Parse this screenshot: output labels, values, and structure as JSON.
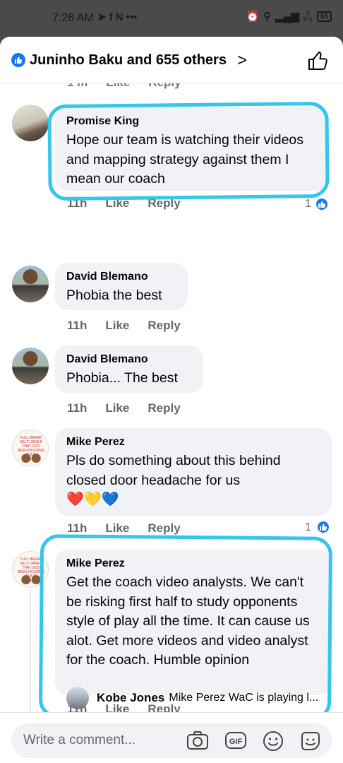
{
  "status": {
    "time": "7:26 AM",
    "speed_top": "3",
    "speed_bottom": "K/s",
    "battery": "65"
  },
  "header": {
    "title": "Juninho Baku and 655 others"
  },
  "top_partial_actions": [
    "1 m",
    "Like",
    "Reply"
  ],
  "comments": [
    {
      "author": "Promise King",
      "text": "Hope our team is watching their videos and mapping strategy against them I mean our coach",
      "time": "11h",
      "like": "Like",
      "reply": "Reply",
      "reactions": "1"
    },
    {
      "author": "David Blemano",
      "text": "Phobia the best",
      "time": "11h",
      "like": "Like",
      "reply": "Reply"
    },
    {
      "author": "David Blemano",
      "text": "Phobia... The best",
      "time": "11h",
      "like": "Like",
      "reply": "Reply"
    },
    {
      "author": "Mike Perez",
      "text": "Pls do something about this behind closed door headache for us",
      "emoji": "❤️💛💙",
      "time": "11h",
      "like": "Like",
      "reply": "Reply",
      "reactions": "1"
    },
    {
      "author": "Mike Perez",
      "text": "Get the coach video analysts. We can't be risking first half to study opponents style of play all the time. It can cause us alot. Get more videos and video analyst for the coach. Humble opinion",
      "time": "11h",
      "like": "Like",
      "reply": "Reply"
    }
  ],
  "reply_preview": {
    "author": "Kobe Jones",
    "snippet": "Mike Perez WaC is playing l..."
  },
  "composer": {
    "placeholder": "Write a comment..."
  },
  "avatar_caption": "FULL BREAK SELTI JAMES THAT GOD BEEN HOLDING YOUR BLESSING",
  "accent_color": "#1877f2",
  "highlight_color": "#35c6ec"
}
